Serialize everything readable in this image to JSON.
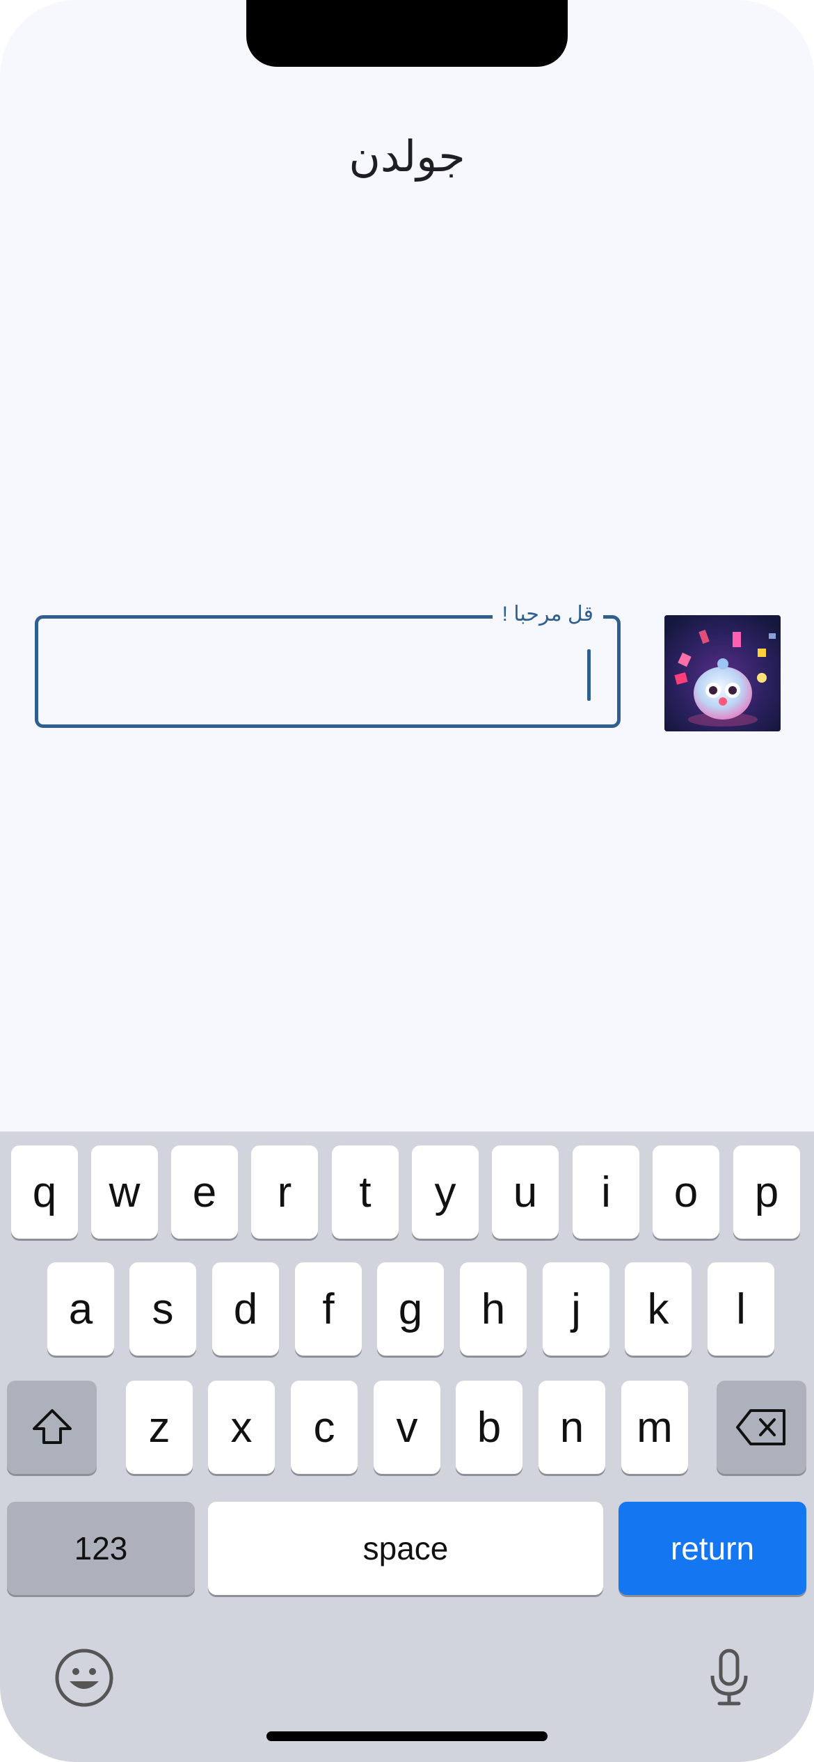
{
  "header": {
    "title": "جولدن"
  },
  "message_input": {
    "label": "قل مرحبا !",
    "value": ""
  },
  "avatar": {
    "icon": "robot-avatar-image"
  },
  "keyboard": {
    "row1": [
      "q",
      "w",
      "e",
      "r",
      "t",
      "y",
      "u",
      "i",
      "o",
      "p"
    ],
    "row2": [
      "a",
      "s",
      "d",
      "f",
      "g",
      "h",
      "j",
      "k",
      "l"
    ],
    "row3": [
      "z",
      "x",
      "c",
      "v",
      "b",
      "n",
      "m"
    ],
    "numbers_label": "123",
    "space_label": "space",
    "return_label": "return",
    "colors": {
      "background": "#d1d4dd",
      "key": "#ffffff",
      "dark_key": "#adb1bc",
      "return_key": "#1476f0"
    }
  }
}
